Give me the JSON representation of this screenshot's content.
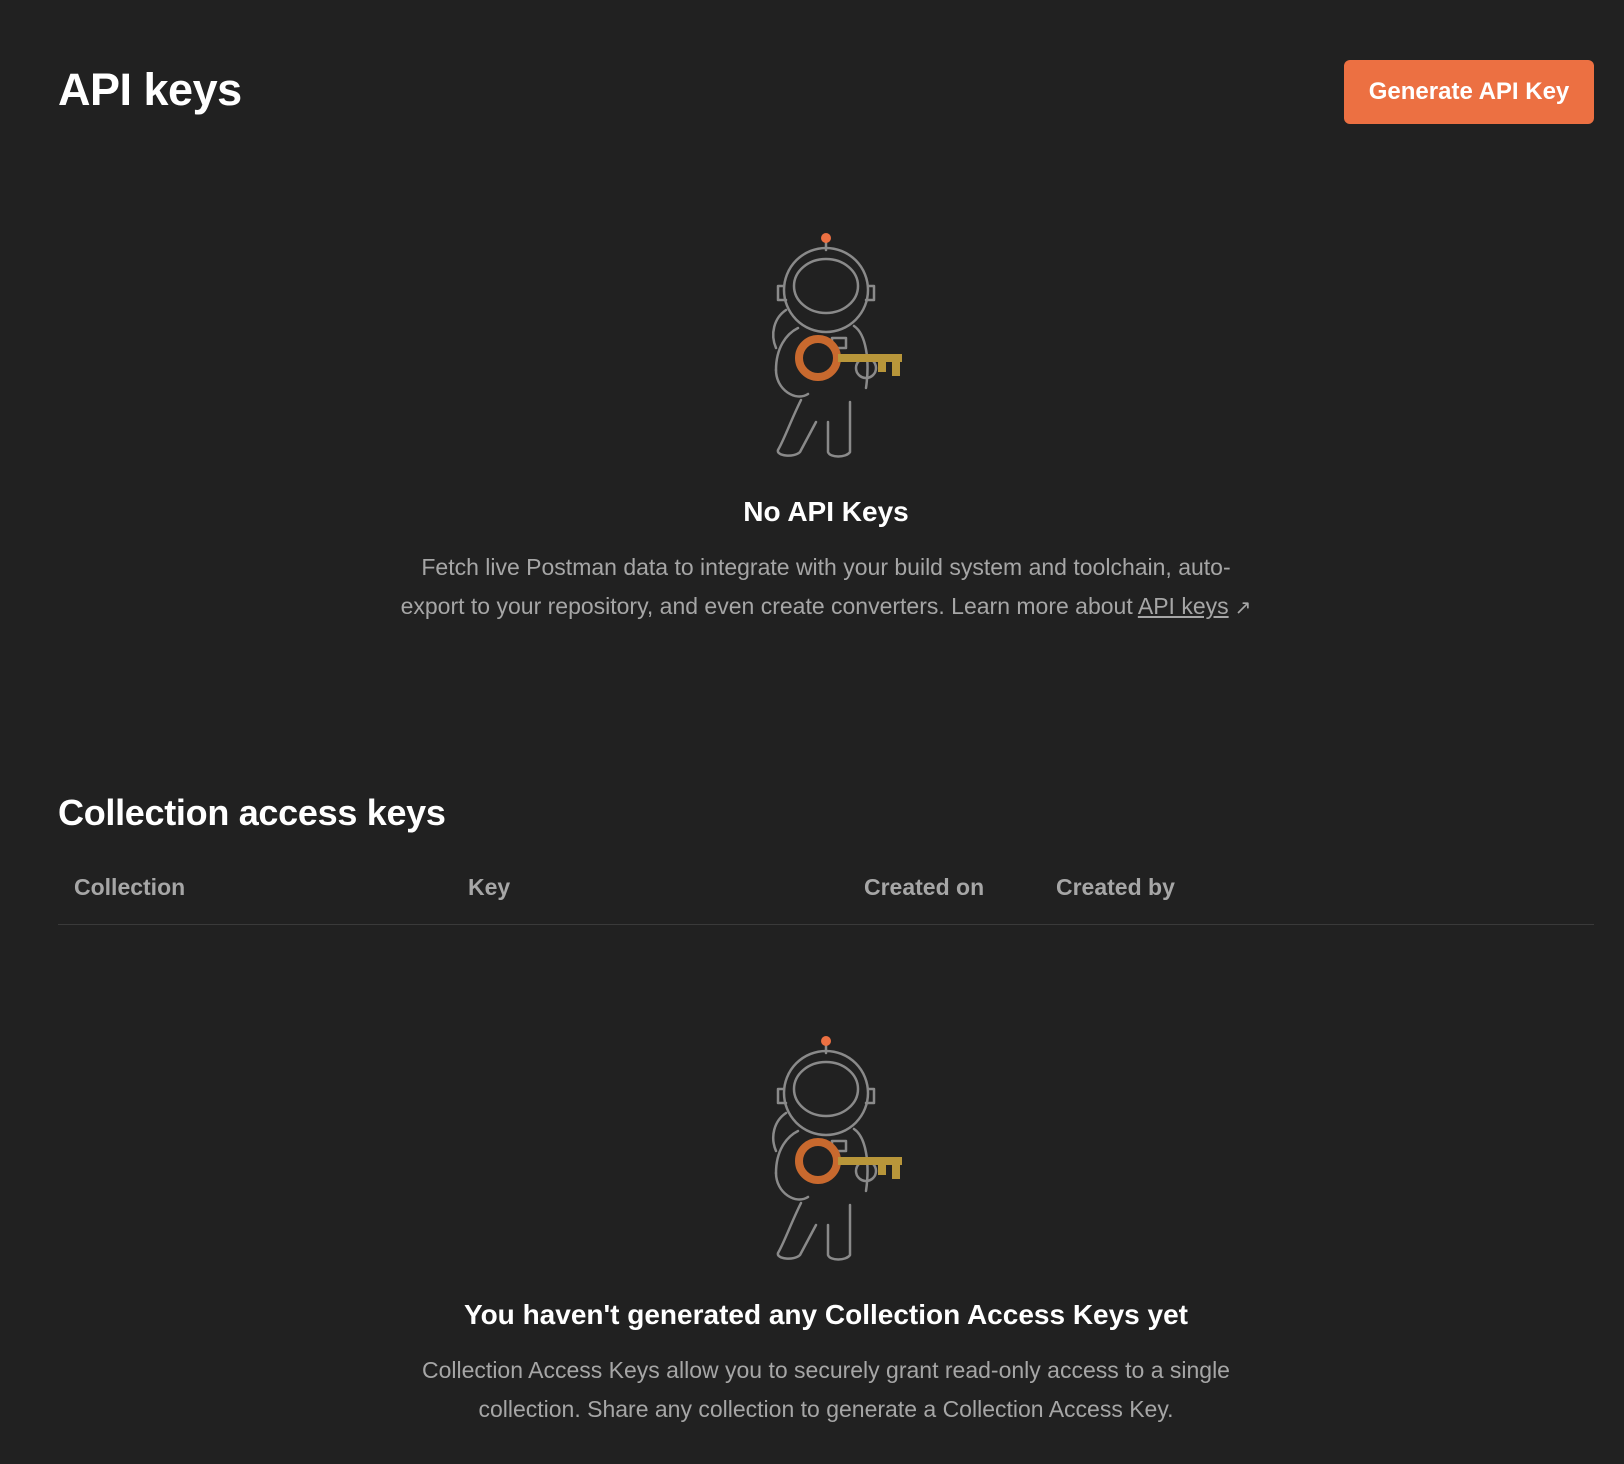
{
  "header": {
    "title": "API keys",
    "generate_button": "Generate API Key"
  },
  "api_empty": {
    "title": "No API Keys",
    "description_prefix": "Fetch live Postman data to integrate with your build system and toolchain, auto-export to your repository, and even create converters. Learn more about ",
    "link_text": "API keys",
    "link_arrow": "↗"
  },
  "collection_keys": {
    "title": "Collection access keys",
    "columns": [
      "Collection",
      "Key",
      "Created on",
      "Created by"
    ],
    "empty_title": "You haven't generated any Collection Access Keys yet",
    "empty_description": "Collection Access Keys allow you to securely grant read-only access to a single collection. Share any collection to generate a Collection Access Key."
  },
  "colors": {
    "background": "#212121",
    "accent": "#ec7042",
    "muted_text": "#a6a6a6"
  },
  "icons": [
    "astronaut-key-illustration",
    "external-link-icon"
  ]
}
